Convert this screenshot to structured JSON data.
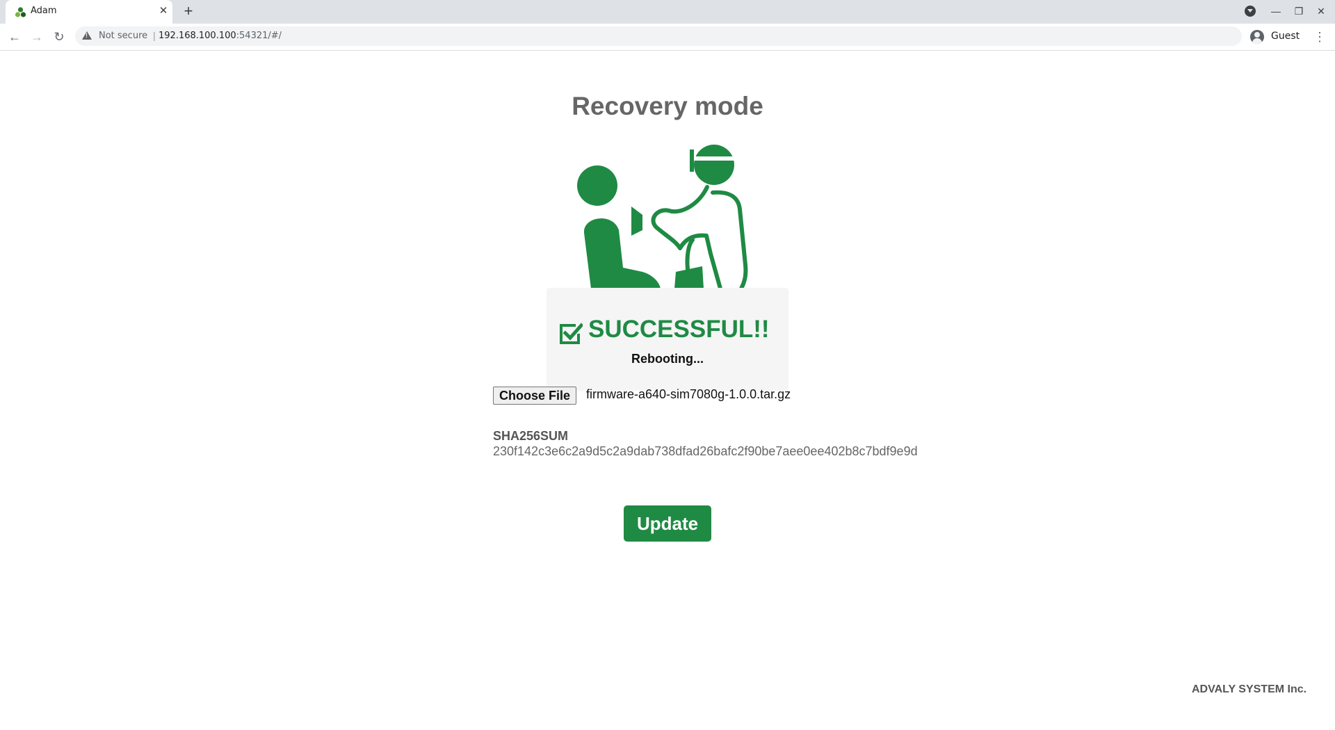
{
  "browser": {
    "tab_title": "Adam",
    "tab_close": "✕",
    "new_tab": "+",
    "security_label": "Not secure",
    "url_host": "192.168.100.100",
    "url_rest": ":54321/#/",
    "profile_label": "Guest",
    "icons": {
      "back": "back-arrow-icon",
      "forward": "forward-arrow-icon",
      "reload": "reload-icon",
      "warning": "warning-icon",
      "menu": "more-vert-icon",
      "minimize": "minimize-icon",
      "restore": "restore-icon",
      "close": "close-icon"
    }
  },
  "page": {
    "title": "Recovery mode",
    "status": {
      "headline": "SUCCESSFUL!!",
      "message": "Rebooting..."
    },
    "file_input": {
      "button_label": "Choose File",
      "file_name": "firmware-a640-sim7080g-1.0.0.tar.gz"
    },
    "checksum": {
      "label": "SHA256SUM",
      "value": "230f142c3e6c2a9d5c2a9dab738dfad26bafc2f90be7aee0ee402b8c7bdf9e9d"
    },
    "update_button": "Update",
    "footer": "ADVALY SYSTEM Inc."
  },
  "colors": {
    "brand_green": "#1f8a44",
    "title_gray": "#666666",
    "overlay_bg": "#f5f5f5"
  }
}
